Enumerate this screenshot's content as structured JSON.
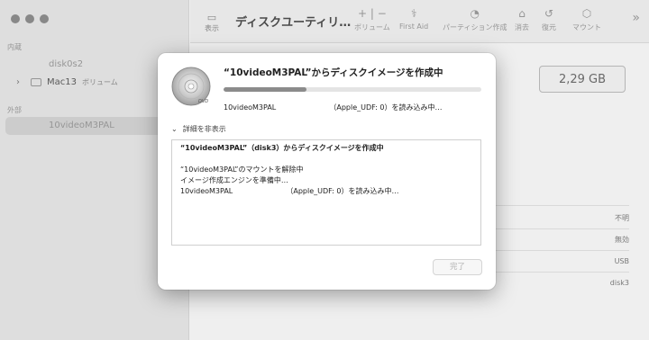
{
  "sidebar": {
    "section_internal": "内蔵",
    "item_disk0s2": "disk0s2",
    "item_mac13": "Mac13",
    "item_mac13_sub": "ボリューム",
    "section_external": "外部",
    "item_external_volume": "10videoM3PAL"
  },
  "toolbar": {
    "view_label": "表示",
    "title": "ディスクユーティリ…",
    "volume_label": "ボリューム",
    "firstaid_label": "First Aid",
    "partition_label": "パーティション作成",
    "erase_label": "消去",
    "restore_label": "復元",
    "mount_label": "マウント"
  },
  "main": {
    "size": "2,29 GB",
    "info": [
      "不明",
      "無効",
      "USB",
      "disk3"
    ]
  },
  "dialog": {
    "title": "“10videoM3PAL”からディスクイメージを作成中",
    "progress": 0.32,
    "status_name": "10videoM3PAL",
    "status_text": "（Apple_UDF: 0）を読み込み中…",
    "details_toggle": "詳細を非表示",
    "log": {
      "line1": "“10videoM3PAL”（disk3）からディスクイメージを作成中",
      "line2": "“10videoM3PAL”のマウントを解除中",
      "line3": "イメージ作成エンジンを準備中…",
      "line4_name": "10videoM3PAL",
      "line4_text": "（Apple_UDF: 0）を読み込み中…"
    },
    "done_label": "完了"
  },
  "colors": {
    "progress_fill": "#8b8b8b",
    "dialog_bg": "#ffffff"
  }
}
